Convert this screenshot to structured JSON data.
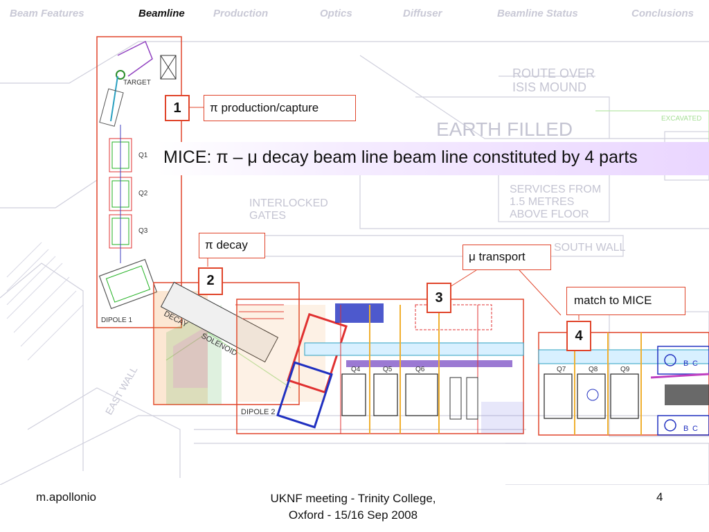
{
  "nav": {
    "items": [
      {
        "label": "Beam Features",
        "active": false
      },
      {
        "label": "Beamline",
        "active": true
      },
      {
        "label": "Production",
        "active": false
      },
      {
        "label": "Optics",
        "active": false
      },
      {
        "label": "Diffuser",
        "active": false
      },
      {
        "label": "Beamline Status",
        "active": false
      },
      {
        "label": "Conclusions",
        "active": false
      }
    ]
  },
  "drawing": {
    "text": {
      "target": "TARGET",
      "q1": "Q1",
      "q2": "Q2",
      "q3": "Q3",
      "dipole1": "DIPOLE 1",
      "dipole2": "DIPOLE 2",
      "decay": "DECAY",
      "solenoid": "SOLENOID",
      "q4": "Q4",
      "q5": "Q5",
      "q6": "Q6",
      "q7": "Q7",
      "q8": "Q8",
      "q9": "Q9",
      "route": "ROUTE OVER",
      "isis": "ISIS MOUND",
      "earth": "EARTH FILLED",
      "interlocked": "INTERLOCKED",
      "gates": "GATES",
      "services1": "SERVICES FROM",
      "services2": "1.5 METRES",
      "services3": "ABOVE FLOOR",
      "southwall": "SOUTH WALL",
      "eastwall": "EAST WALL",
      "excavated": "EXCAVATED",
      "b": "B",
      "c": "C"
    }
  },
  "labels": {
    "production": "π production/capture",
    "decay": "π decay",
    "transport": "μ transport",
    "match": "match to MICE",
    "n1": "1",
    "n2": "2",
    "n3": "3",
    "n4": "4"
  },
  "banner": "MICE: π – μ decay beam line beam line constituted by 4 parts",
  "footer": {
    "author": "m.apollonio",
    "meeting_line1": "UKNF meeting - Trinity College,",
    "meeting_line2": "Oxford - 15/16 Sep 2008",
    "page": "4"
  },
  "colors": {
    "accent": "#e0442a",
    "nav_inactive": "#c9c9d6",
    "banner_purple": "#ead6ff"
  }
}
